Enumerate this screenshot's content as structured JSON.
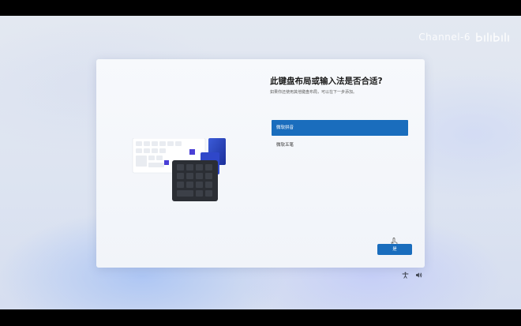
{
  "watermark": {
    "text": "Channel-6"
  },
  "dialog": {
    "title": "此键盘布局或输入法是否合适?",
    "subtitle": "如果你还使用其他键盘布局，可以在下一步添加。",
    "options": [
      {
        "label": "微软拼音",
        "selected": true
      },
      {
        "label": "微软五笔",
        "selected": false
      }
    ],
    "primary_button": "是"
  },
  "tray": {
    "icons": [
      "accessibility-icon",
      "volume-icon"
    ]
  },
  "colors": {
    "accent": "#1a6dbd",
    "dialog_bg": "#f4f6fa"
  }
}
